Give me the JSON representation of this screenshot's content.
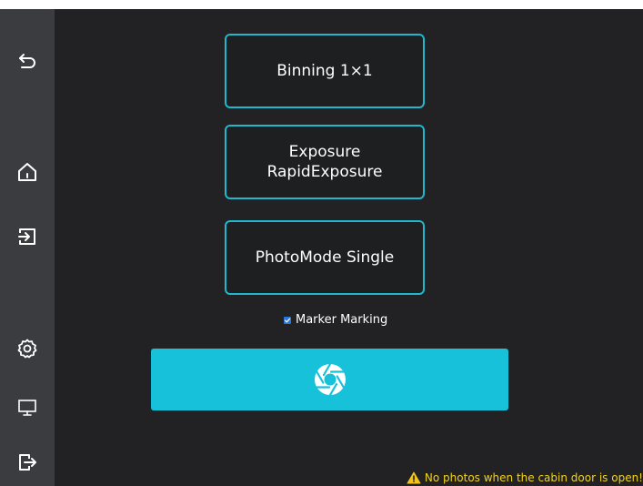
{
  "sidebar": {
    "items": [
      {
        "icon": "back-icon"
      },
      {
        "icon": "home-icon"
      },
      {
        "icon": "login-icon"
      },
      {
        "icon": "settings-icon"
      },
      {
        "icon": "monitor-icon"
      },
      {
        "icon": "logout-icon"
      }
    ]
  },
  "options": {
    "binning_label": "Binning 1×1",
    "exposure_line1": "Exposure",
    "exposure_line2": "RapidExposure",
    "photomode_label": "PhotoMode Single"
  },
  "marker": {
    "label": "Marker Marking",
    "checked": true
  },
  "capture": {
    "icon": "camera-shutter-icon"
  },
  "warning": {
    "text": "No photos when the cabin door is open!",
    "icon": "warning-icon"
  },
  "colors": {
    "accent": "#17c1d9",
    "border": "#1fb8cc",
    "warning": "#f2d21b",
    "background": "#222224",
    "sidebar": "#3a3c40"
  }
}
